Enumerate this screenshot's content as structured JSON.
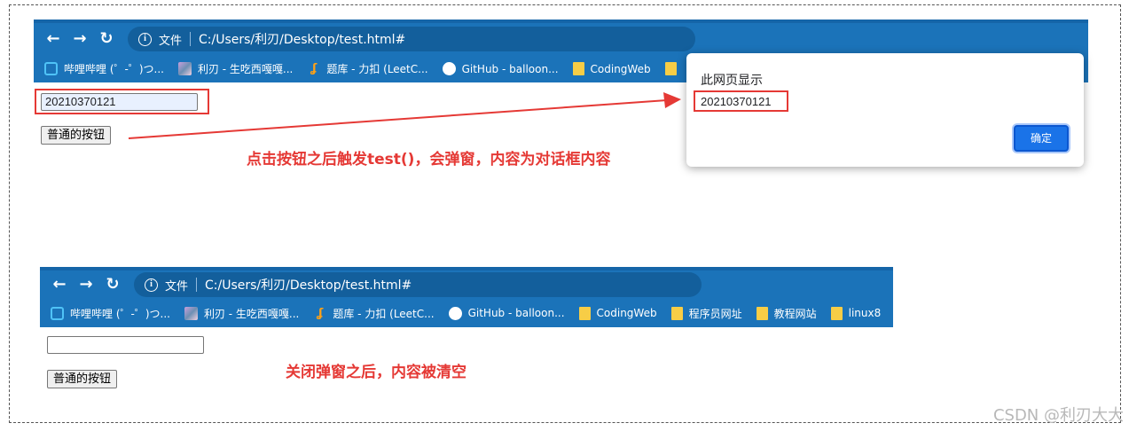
{
  "browser_top": {
    "url_scheme": "文件",
    "url": "C:/Users/利刃/Desktop/test.html#",
    "bookmarks": [
      {
        "label": "哔哩哔哩 (゜-゜)つ...",
        "icon": "bilibili-icon"
      },
      {
        "label": "利刃 - 生吃西嘎嘎...",
        "icon": "avatar-image-icon"
      },
      {
        "label": "题库 - 力扣 (LeetC...",
        "icon": "leetcode-icon"
      },
      {
        "label": "GitHub - balloon...",
        "icon": "github-icon"
      },
      {
        "label": "CodingWeb",
        "icon": "folder-icon"
      }
    ]
  },
  "page_top": {
    "input_value": "20210370121",
    "button_label": "普通的按钮",
    "annotation": "点击按钮之后触发test()，会弹窗，内容为对话框内容"
  },
  "dialog": {
    "title": "此网页显示",
    "message": "20210370121",
    "ok_label": "确定"
  },
  "browser_bottom": {
    "url_scheme": "文件",
    "url": "C:/Users/利刃/Desktop/test.html#",
    "bookmarks": [
      {
        "label": "哔哩哔哩 (゜-゜)つ...",
        "icon": "bilibili-icon"
      },
      {
        "label": "利刃 - 生吃西嘎嘎...",
        "icon": "avatar-image-icon"
      },
      {
        "label": "题库 - 力扣 (LeetC...",
        "icon": "leetcode-icon"
      },
      {
        "label": "GitHub - balloon...",
        "icon": "github-icon"
      },
      {
        "label": "CodingWeb",
        "icon": "folder-icon"
      },
      {
        "label": "程序员网址",
        "icon": "folder-icon"
      },
      {
        "label": "教程网站",
        "icon": "folder-icon"
      },
      {
        "label": "linux8",
        "icon": "folder-icon"
      }
    ]
  },
  "page_bottom": {
    "input_value": "",
    "button_label": "普通的按钮",
    "annotation": "关闭弹窗之后，内容被清空"
  },
  "watermark": "CSDN @利刃大大",
  "colors": {
    "chrome_blue": "#1b73b9",
    "annotation_red": "#e53935",
    "dialog_button": "#1a73e8"
  }
}
